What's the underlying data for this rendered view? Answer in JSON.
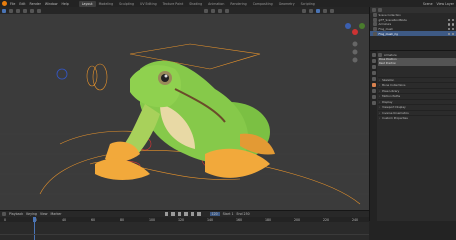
{
  "menu": {
    "items": [
      "File",
      "Edit",
      "Render",
      "Window",
      "Help"
    ],
    "workspaces": [
      "Layout",
      "Modeling",
      "Sculpting",
      "UV Editing",
      "Texture Paint",
      "Shading",
      "Animation",
      "Rendering",
      "Compositing",
      "Geometry",
      "Scripting"
    ],
    "right": [
      "Scene",
      "View Layer"
    ]
  },
  "outliner": {
    "rows": [
      {
        "label": "Scene Collection",
        "selected": false
      },
      {
        "label": "glTF_SceneRootNode",
        "selected": false
      },
      {
        "label": "Armature",
        "selected": false
      },
      {
        "label": "Frog_mesh",
        "selected": false
      },
      {
        "label": "Frog_mesh_rig",
        "selected": true
      }
    ]
  },
  "properties": {
    "name": "Armature",
    "fields": [
      "Pose Position",
      "Rest Position"
    ],
    "sections": [
      "Skeleton",
      "Bone Collections",
      "Pose Library",
      "Motion Paths",
      "Display",
      "Viewport Display",
      "Inverse Kinematics",
      "Custom Properties"
    ]
  },
  "timeline": {
    "labels": [
      "Playback",
      "Keying",
      "View",
      "Marker"
    ],
    "frame": "120",
    "start": "Start 1",
    "end": "End 250",
    "ticks": [
      "0",
      "20",
      "40",
      "60",
      "80",
      "100",
      "120",
      "140",
      "160",
      "180",
      "200",
      "220",
      "240"
    ]
  },
  "colors": {
    "accent": "#e87d0d",
    "selected": "#3e5a85",
    "frog_green": "#7bc043",
    "frog_orange": "#f2a93b"
  }
}
